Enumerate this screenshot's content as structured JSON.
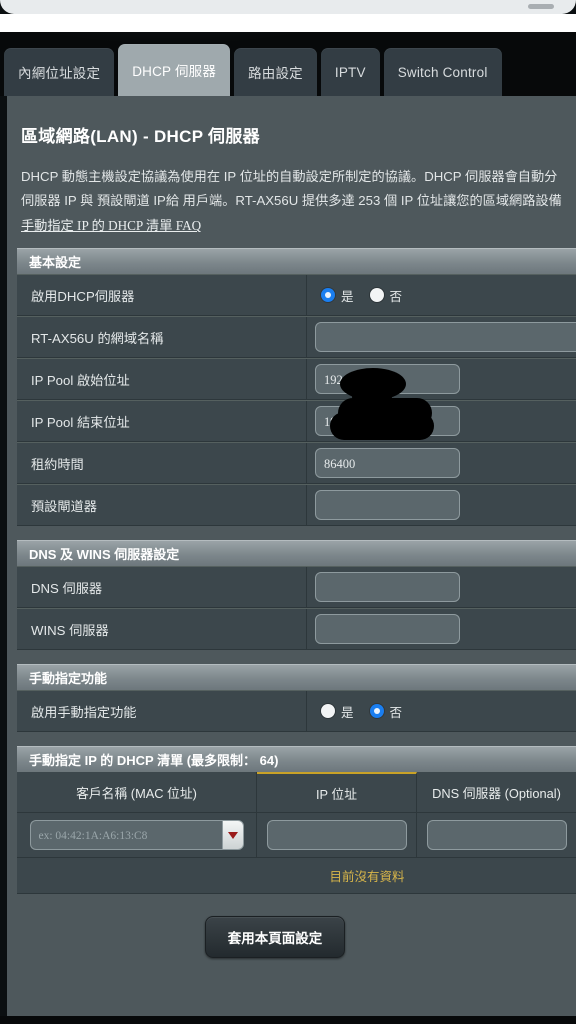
{
  "browser": {
    "address_pill": ""
  },
  "tabs": [
    {
      "label": "內網位址設定",
      "active": false
    },
    {
      "label": "DHCP 伺服器",
      "active": true
    },
    {
      "label": "路由設定",
      "active": false
    },
    {
      "label": "IPTV",
      "active": false
    },
    {
      "label": "Switch Control",
      "active": false
    }
  ],
  "page": {
    "title": "區域網路(LAN) - DHCP 伺服器",
    "desc_line1": "DHCP 動態主機設定協議為使用在 IP 位址的自動設定所制定的協議。DHCP 伺服器會自動分",
    "desc_line2": "伺服器 IP 與 預設閘道 IP給 用戶端。RT-AX56U 提供多達 253 個 IP 位址讓您的區域網路設備",
    "faq_link": "手動指定 IP 的 DHCP 清單 FAQ"
  },
  "basic": {
    "header": "基本設定",
    "rows": [
      {
        "label": "啟用DHCP伺服器",
        "type": "radio",
        "yes": "是",
        "no": "否",
        "selected": "yes"
      },
      {
        "label": "RT-AX56U 的網域名稱",
        "type": "text",
        "value": "",
        "wide": true
      },
      {
        "label": "IP Pool 啟始位址",
        "type": "text",
        "value": "192.16"
      },
      {
        "label": "IP Pool 結束位址",
        "type": "text",
        "value": "192.1"
      },
      {
        "label": "租約時間",
        "type": "text",
        "value": "86400"
      },
      {
        "label": "預設閘道器",
        "type": "text",
        "value": ""
      }
    ]
  },
  "dns": {
    "header": "DNS 及 WINS 伺服器設定",
    "rows": [
      {
        "label": "DNS 伺服器",
        "type": "text",
        "value": "",
        "wide": true
      },
      {
        "label": "WINS 伺服器",
        "type": "text",
        "value": "",
        "wide": true
      }
    ]
  },
  "manual": {
    "header": "手動指定功能",
    "rows": [
      {
        "label": "啟用手動指定功能",
        "type": "radio",
        "yes": "是",
        "no": "否",
        "selected": "no"
      }
    ]
  },
  "list": {
    "header": "手動指定 IP 的 DHCP 清單 (最多限制：  64)",
    "columns": [
      "客戶名稱 (MAC 位址)",
      "IP 位址",
      "DNS 伺服器 (Optional)",
      ""
    ],
    "mac_placeholder": "ex: 04:42:1A:A6:13:C8",
    "ip_value": "",
    "dns_value": "",
    "empty_text": "目前沒有資料"
  },
  "footer": {
    "apply_label": "套用本頁面設定"
  },
  "colors": {
    "accent_blue": "#1a7ef0",
    "warning_yellow": "#d8b64a",
    "panel_bg": "#4e585c",
    "row_bg": "#3c474c",
    "active_tab": "#9fa9ad"
  }
}
